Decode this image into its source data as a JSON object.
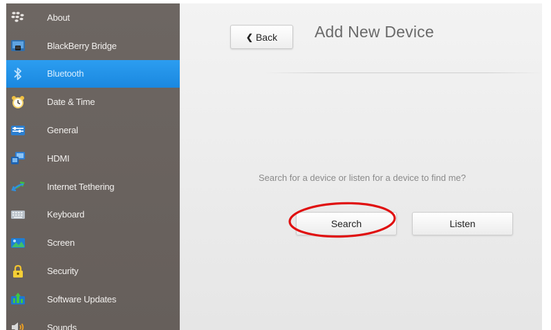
{
  "sidebar": {
    "items": [
      {
        "label": "About",
        "icon": "blackberry-logo-icon"
      },
      {
        "label": "BlackBerry Bridge",
        "icon": "bridge-icon"
      },
      {
        "label": "Bluetooth",
        "icon": "bluetooth-icon",
        "active": true
      },
      {
        "label": "Date & Time",
        "icon": "clock-icon"
      },
      {
        "label": "General",
        "icon": "general-icon"
      },
      {
        "label": "HDMI",
        "icon": "hdmi-icon"
      },
      {
        "label": "Internet Tethering",
        "icon": "tethering-icon"
      },
      {
        "label": "Keyboard",
        "icon": "keyboard-icon"
      },
      {
        "label": "Screen",
        "icon": "screen-icon"
      },
      {
        "label": "Security",
        "icon": "lock-icon"
      },
      {
        "label": "Software Updates",
        "icon": "software-updates-icon"
      },
      {
        "label": "Sounds",
        "icon": "speaker-icon"
      }
    ]
  },
  "header": {
    "back_label": "Back",
    "title": "Add New Device"
  },
  "main": {
    "prompt": "Search for a device or listen for a device to find me?",
    "search_label": "Search",
    "listen_label": "Listen"
  },
  "colors": {
    "sidebar_bg": "#6b6460",
    "active_item": "#1f8fe6",
    "highlight_ring": "#e01010"
  }
}
